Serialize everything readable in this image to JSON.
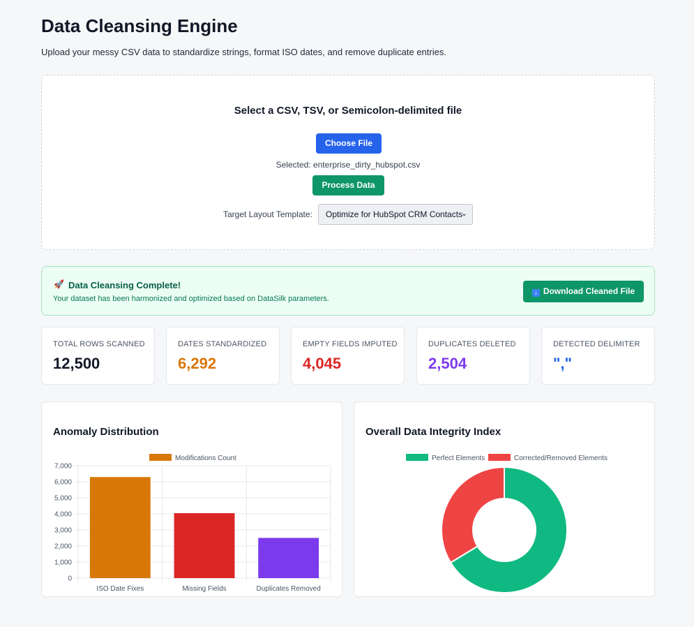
{
  "header": {
    "title": "Data Cleansing Engine",
    "subtitle": "Upload your messy CSV data to standardize strings, format ISO dates, and remove duplicate entries."
  },
  "upload": {
    "heading": "Select a CSV, TSV, or Semicolon-delimited file",
    "choose_label": "Choose File",
    "selected_text": "Selected: enterprise_dirty_hubspot.csv",
    "process_label": "Process Data",
    "template_label": "Target Layout Template:",
    "template_value": "Optimize for HubSpot CRM Contacts"
  },
  "banner": {
    "title": "Data Cleansing Complete!",
    "message": "Your dataset has been harmonized and optimized based on DataSilk parameters.",
    "download_label": "Download Cleaned File",
    "icon": "rocket-icon"
  },
  "stats": [
    {
      "label": "TOTAL ROWS SCANNED",
      "value": "12,500",
      "color": "#111827"
    },
    {
      "label": "DATES STANDARDIZED",
      "value": "6,292",
      "color": "#d97706"
    },
    {
      "label": "EMPTY FIELDS IMPUTED",
      "value": "4,045",
      "color": "#dc2626"
    },
    {
      "label": "DUPLICATES DELETED",
      "value": "2,504",
      "color": "#7c3aed"
    },
    {
      "label": "DETECTED DELIMITER",
      "value": "\",\"",
      "color": "#2563eb"
    }
  ],
  "charts": {
    "bar_title": "Anomaly Distribution",
    "donut_title": "Overall Data Integrity Index"
  },
  "chart_data": [
    {
      "type": "bar",
      "title": "Anomaly Distribution",
      "categories": [
        "ISO Date Fixes",
        "Missing Fields",
        "Duplicates Removed"
      ],
      "series": [
        {
          "name": "Modifications Count",
          "values": [
            6292,
            4045,
            2504
          ]
        }
      ],
      "colors": [
        "#d97706",
        "#dc2626",
        "#7c3aed"
      ],
      "ylim": [
        0,
        7000
      ],
      "yticks": [
        0,
        1000,
        2000,
        3000,
        4000,
        5000,
        6000,
        7000
      ],
      "ytick_labels": [
        "0",
        "1,000",
        "2,000",
        "3,000",
        "4,000",
        "5,000",
        "6,000",
        "7,000"
      ],
      "legend": "top",
      "grid": true
    },
    {
      "type": "pie",
      "title": "Overall Data Integrity Index",
      "labels": [
        "Perfect Elements",
        "Corrected/Removed Elements"
      ],
      "values": [
        66.3,
        33.7
      ],
      "colors": [
        "#10b981",
        "#ef4444"
      ],
      "legend": "top"
    }
  ]
}
